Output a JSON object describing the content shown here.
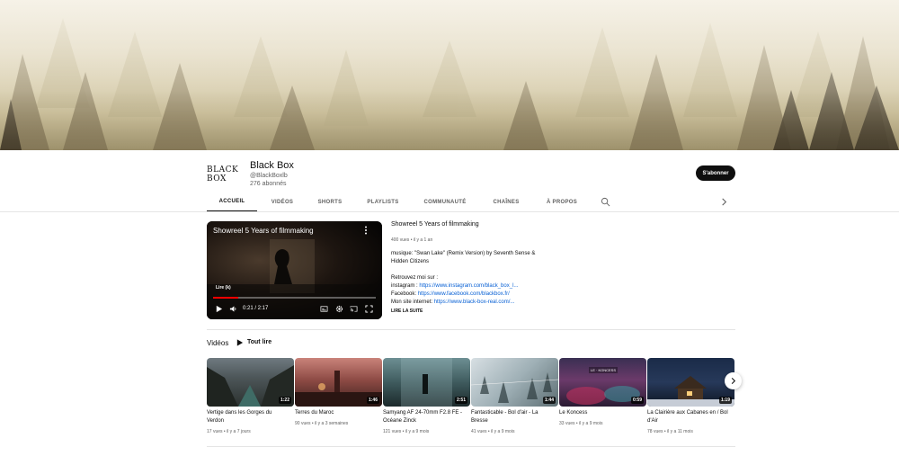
{
  "channel": {
    "logo_text_line1": "BLACK",
    "logo_text_line2": "BOX",
    "name": "Black Box",
    "handle": "@BlackBoxlb",
    "subscribers": "276 abonnés",
    "subscribe_label": "S'abonner"
  },
  "tabs": [
    {
      "label": "ACCUEIL",
      "active": true
    },
    {
      "label": "VIDÉOS",
      "active": false
    },
    {
      "label": "SHORTS",
      "active": false
    },
    {
      "label": "PLAYLISTS",
      "active": false
    },
    {
      "label": "COMMUNAUTÉ",
      "active": false
    },
    {
      "label": "CHAÎNES",
      "active": false
    },
    {
      "label": "À PROPOS",
      "active": false
    }
  ],
  "icons": {
    "search": "search-icon",
    "tabs_next": "chevron-right-icon",
    "player_menu": "more-vert-icon",
    "play": "play-icon",
    "volume": "volume-icon",
    "subtitles": "subtitles-icon",
    "settings": "gear-icon",
    "cast": "cast-icon",
    "fullscreen": "fullscreen-icon",
    "shelf_next": "chevron-right-icon"
  },
  "featured": {
    "player_title": "Showreel 5 Years of filmmaking",
    "overlay_label": "Lire (k)",
    "time": "0:21 / 2:17",
    "progress": 0.153,
    "title": "Showreel 5 Years of filmmaking",
    "views": "400 vues",
    "age": "il y a 1 an",
    "desc_line1": "musique: \"Swan Lake\" (Remix Version) by Seventh Sense &",
    "desc_line2": "Hidden Citizens",
    "desc_line3": "Retrouvez moi sur :",
    "instagram_label": "instagram : ",
    "instagram_link": "https://www.instagram.com/black_box_l...",
    "facebook_label": "Facebook: ",
    "facebook_link": "https://www.facebook.com/blackbox.fr/",
    "site_label": "Mon site internet: ",
    "site_link": "https://www.black-box-real.com/...",
    "read_more": "LIRE LA SUITE"
  },
  "shelf": {
    "title": "Vidéos",
    "play_all": "Tout lire",
    "videos": [
      {
        "title": "Vertige dans les Gorges du Verdon",
        "duration": "1:22",
        "views": "17 vues",
        "age": "il y a 7 jours"
      },
      {
        "title": "Terres du Maroc",
        "duration": "1:46",
        "views": "90 vues",
        "age": "il y a 3 semaines"
      },
      {
        "title": "Samyang AF 24-70mm F2.8 FE - Océane Zinck",
        "duration": "2:51",
        "views": "121 vues",
        "age": "il y a 9 mois"
      },
      {
        "title": "Fantasticable - Bol d'air - La Bresse",
        "duration": "1:44",
        "views": "41 vues",
        "age": "il y a 9 mois"
      },
      {
        "title": "Le Koncess",
        "duration": "0:59",
        "views": "33 vues",
        "age": "il y a 9 mois",
        "thumb_text": "LE · KONCESS"
      },
      {
        "title": "La Clairière aux Cabanes en / Bol d'Air",
        "duration": "1:19",
        "views": "78 vues",
        "age": "il y a 11 mois"
      }
    ]
  },
  "colors": {
    "accent_red": "#ff0000",
    "link_blue": "#065fd4",
    "text_primary": "#0f0f0f",
    "text_secondary": "#606060"
  }
}
